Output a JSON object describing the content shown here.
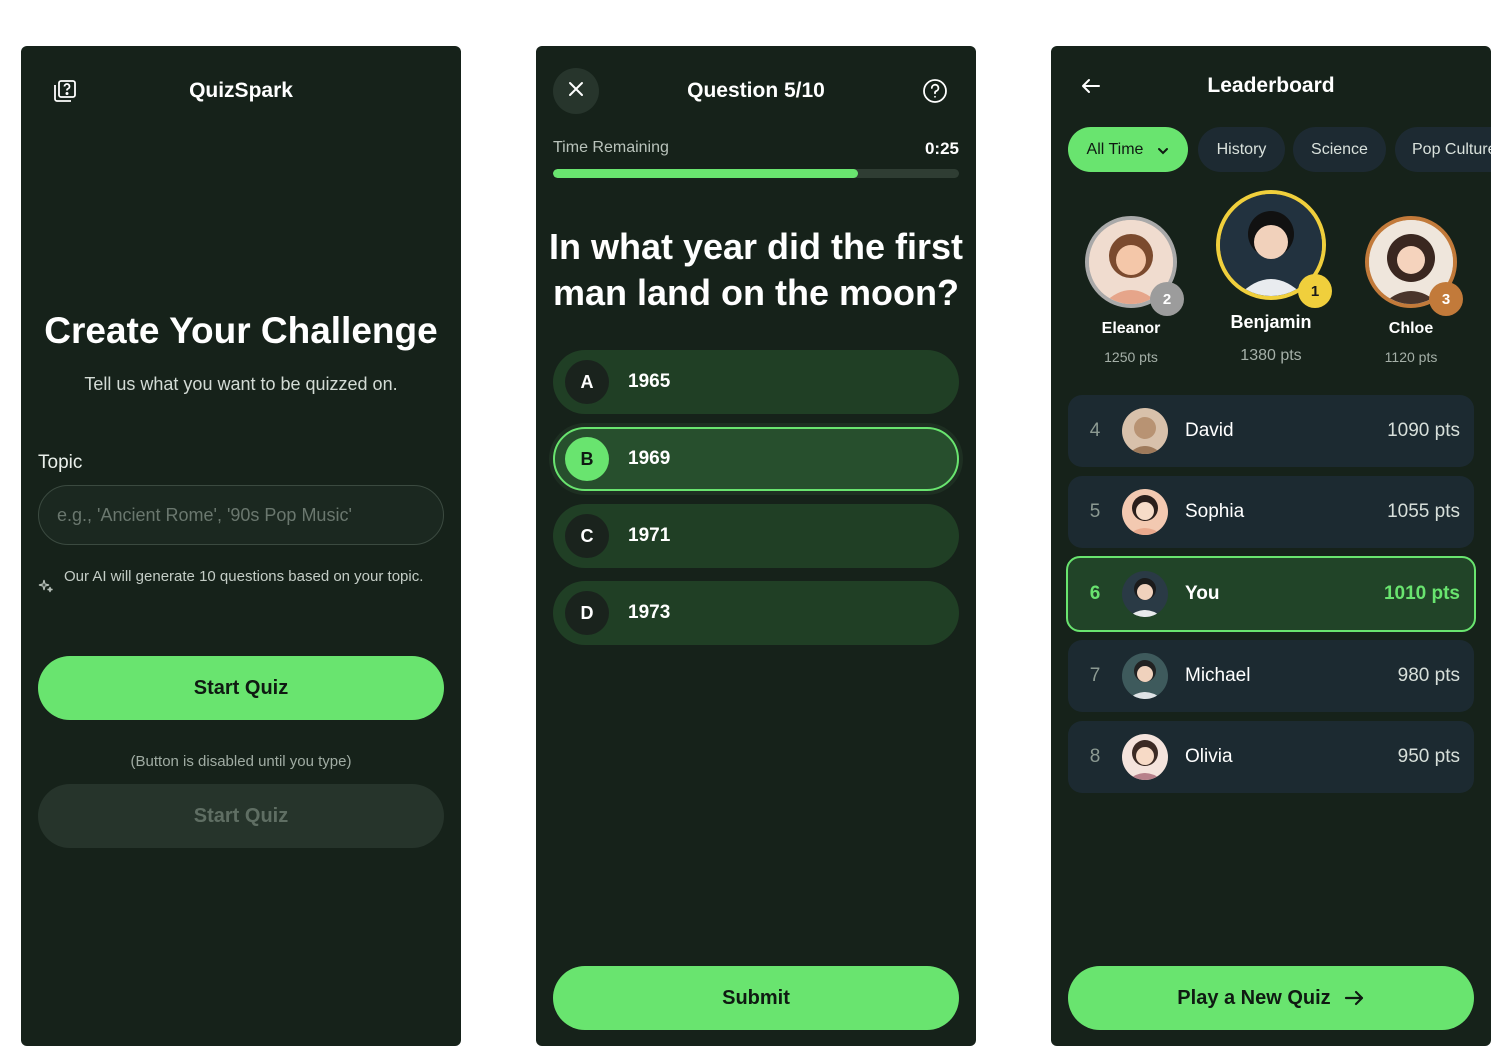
{
  "colors": {
    "background": "#16221a",
    "accent": "#69e46f",
    "chip": "#1d2a32",
    "option": "#203f25",
    "gold": "#f0cf3c",
    "silver": "#a9a9a9",
    "bronze": "#c27a3a"
  },
  "create": {
    "app_title": "QuizSpark",
    "header_icon": "quiz-cards-icon",
    "heading": "Create Your Challenge",
    "subheading": "Tell us what you want to be quizzed on.",
    "topic_label": "Topic",
    "topic_value": "",
    "topic_placeholder": "e.g., 'Ancient Rome', '90s Pop Music'",
    "hint_icon": "sparkle-icon",
    "hint": "Our AI will generate 10 questions based on your topic.",
    "start_label": "Start Quiz",
    "disabled_note": "(Button is disabled until you type)",
    "start_disabled_label": "Start Quiz"
  },
  "question": {
    "close_icon": "close-icon",
    "title": "Question 5/10",
    "help_icon": "help-icon",
    "time_label": "Time Remaining",
    "time_value": "0:25",
    "time_progress": 0.75,
    "text": "In what year did the first man land on the moon?",
    "options": [
      {
        "letter": "A",
        "value": "1965",
        "selected": false
      },
      {
        "letter": "B",
        "value": "1969",
        "selected": true
      },
      {
        "letter": "C",
        "value": "1971",
        "selected": false
      },
      {
        "letter": "D",
        "value": "1973",
        "selected": false
      }
    ],
    "submit_label": "Submit"
  },
  "leaderboard": {
    "back_icon": "arrow-left-icon",
    "title": "Leaderboard",
    "filters": [
      {
        "label": "All Time",
        "active": true,
        "icon": "chevron-down-icon"
      },
      {
        "label": "History",
        "active": false
      },
      {
        "label": "Science",
        "active": false
      },
      {
        "label": "Pop Culture",
        "active": false
      }
    ],
    "podium": [
      {
        "rank": "2",
        "name": "Eleanor",
        "points": "1250 pts"
      },
      {
        "rank": "1",
        "name": "Benjamin",
        "points": "1380 pts"
      },
      {
        "rank": "3",
        "name": "Chloe",
        "points": "1120 pts"
      }
    ],
    "rows": [
      {
        "rank": "4",
        "name": "David",
        "points": "1090 pts",
        "me": false
      },
      {
        "rank": "5",
        "name": "Sophia",
        "points": "1055 pts",
        "me": false
      },
      {
        "rank": "6",
        "name": "You",
        "points": "1010 pts",
        "me": true
      },
      {
        "rank": "7",
        "name": "Michael",
        "points": "980 pts",
        "me": false
      },
      {
        "rank": "8",
        "name": "Olivia",
        "points": "950 pts",
        "me": false
      }
    ],
    "play_label": "Play a New Quiz",
    "play_icon": "arrow-right-icon"
  }
}
